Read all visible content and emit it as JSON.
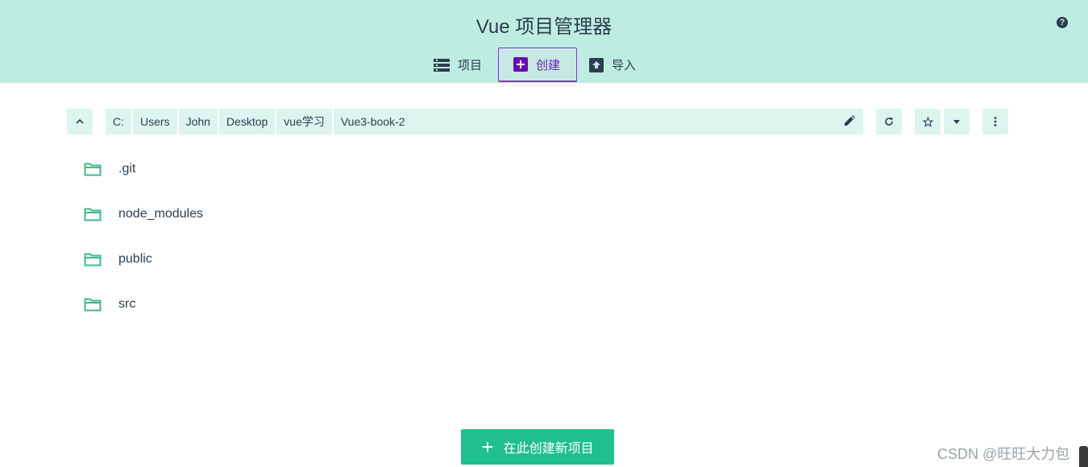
{
  "header": {
    "title": "Vue 项目管理器",
    "help_icon": "help-circle-icon",
    "background": "#beece1"
  },
  "tabs": [
    {
      "label": "项目",
      "icon": "list-icon",
      "active": false
    },
    {
      "label": "创建",
      "icon": "plus-box-icon",
      "active": true
    },
    {
      "label": "导入",
      "icon": "import-icon",
      "active": false
    }
  ],
  "path": {
    "segments": [
      "C:",
      "Users",
      "John",
      "Desktop",
      "vue学习",
      "Vue3-book-2"
    ],
    "edit_icon": "pencil-icon"
  },
  "toolbar_icons": {
    "up": "chevron-up-icon",
    "refresh": "refresh-icon",
    "favorite": "star-outline-icon",
    "favorites_menu": "caret-down-icon",
    "more": "more-vertical-icon"
  },
  "folders": [
    ".git",
    "node_modules",
    "public",
    "src"
  ],
  "create_button": {
    "label": "在此创建新项目",
    "icon": "plus-icon",
    "color": "#1fbf8f"
  },
  "watermark": "CSDN @旺旺大力包",
  "accent_color": "#42b983",
  "active_tab_color": "#8a2be2"
}
